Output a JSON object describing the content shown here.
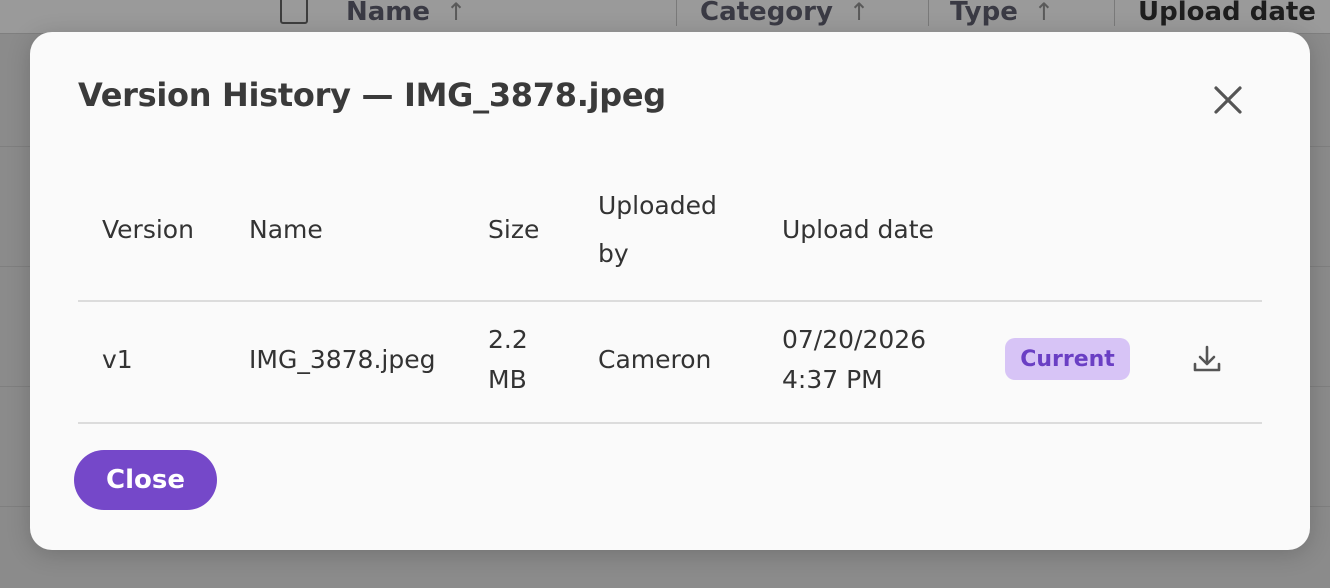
{
  "background": {
    "columns": [
      {
        "label": "Name",
        "sort_icon": "arrow-up-icon"
      },
      {
        "label": "Category",
        "sort_icon": "arrow-up-icon"
      },
      {
        "label": "Type",
        "sort_icon": "arrow-up-icon"
      },
      {
        "label": "Upload date"
      }
    ]
  },
  "modal": {
    "title": "Version History — IMG_3878.jpeg",
    "close_icon": "close-icon",
    "table": {
      "headers": [
        "Version",
        "Name",
        "Size",
        "Uploaded by",
        "Upload date"
      ],
      "rows": [
        {
          "version": "v1",
          "name": "IMG_3878.jpeg",
          "size": "2.2 MB",
          "uploaded_by": "Cameron",
          "upload_date": "07/20/2026",
          "upload_time": "4:37 PM",
          "status": "Current",
          "action_icon": "download-icon"
        }
      ]
    },
    "close_button_label": "Close"
  },
  "colors": {
    "accent": "#7548c9",
    "badge_bg": "#d7c4f6",
    "badge_text": "#6a3fc4"
  }
}
